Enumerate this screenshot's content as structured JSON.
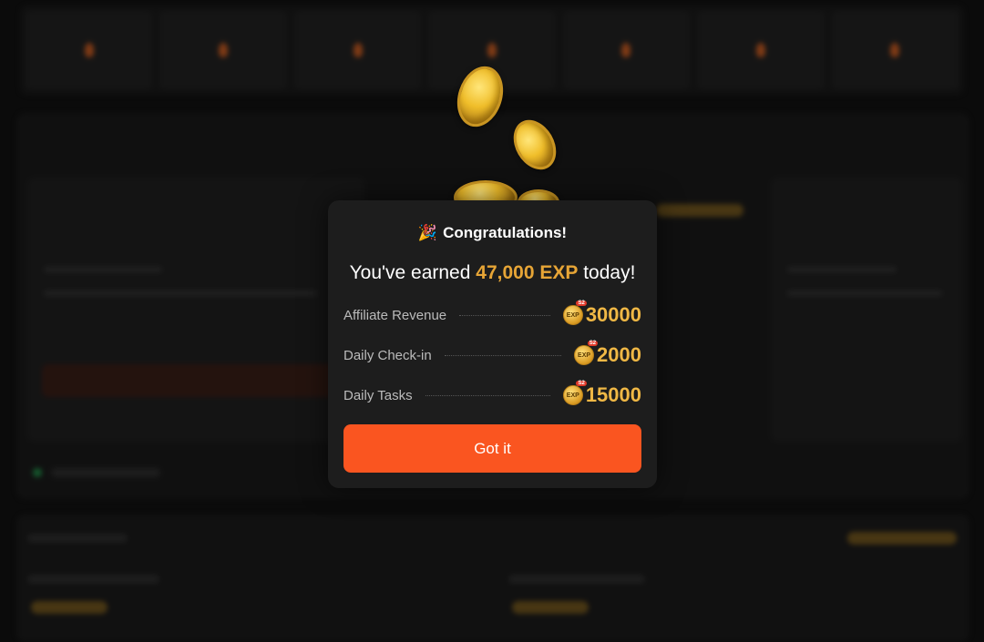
{
  "modal": {
    "title": "Congratulations!",
    "earned_prefix": "You've earned",
    "earned_amount": "47,000 EXP",
    "earned_suffix": "today!",
    "rows": [
      {
        "label": "Affiliate Revenue",
        "value": "30000"
      },
      {
        "label": "Daily Check-in",
        "value": "2000"
      },
      {
        "label": "Daily Tasks",
        "value": "15000"
      }
    ],
    "coin_icon_text": "EXP",
    "coin_badge_text": "S2",
    "button_label": "Got it"
  },
  "icons": {
    "party": "party-popper-icon",
    "coin": "exp-coin-icon"
  },
  "colors": {
    "accent": "#fa5520",
    "gold": "#f0b845",
    "modal_bg": "#1d1d1d"
  }
}
